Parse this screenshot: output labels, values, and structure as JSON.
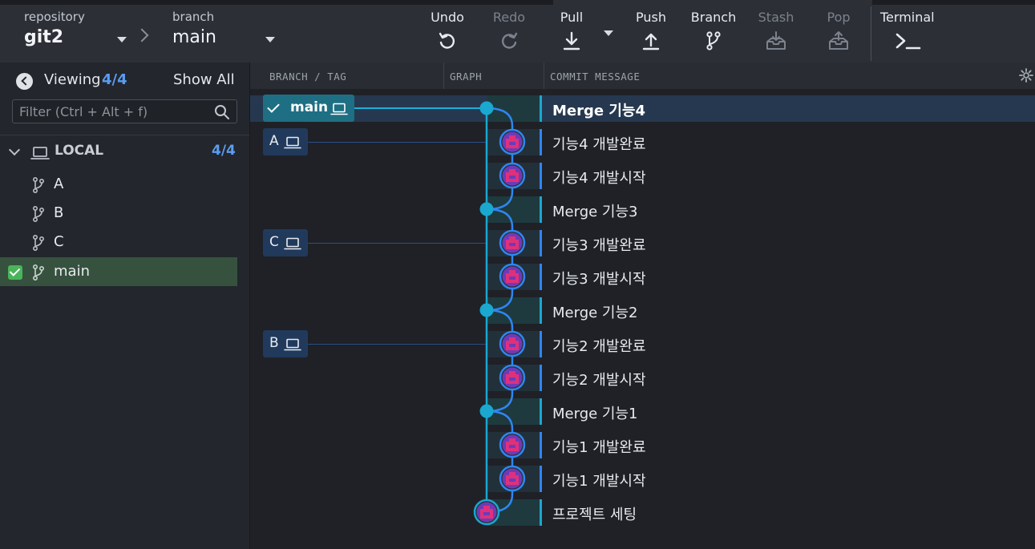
{
  "toolbar": {
    "repository_caption": "repository",
    "repository_name": "git2",
    "branch_caption": "branch",
    "branch_name": "main",
    "undo": "Undo",
    "redo": "Redo",
    "pull": "Pull",
    "push": "Push",
    "branch": "Branch",
    "stash": "Stash",
    "pop": "Pop",
    "terminal": "Terminal"
  },
  "sidebar": {
    "viewing_label": "Viewing",
    "viewing_count": "4/4",
    "show_all": "Show All",
    "filter_placeholder": "Filter (Ctrl + Alt + f)",
    "local_label": "LOCAL",
    "local_count": "4/4",
    "branches": [
      {
        "name": "A",
        "checked_out": false
      },
      {
        "name": "B",
        "checked_out": false
      },
      {
        "name": "C",
        "checked_out": false
      },
      {
        "name": "main",
        "checked_out": true
      }
    ]
  },
  "graph": {
    "col_branch_tag": "BRANCH / TAG",
    "col_graph": "GRAPH",
    "col_commit_message": "COMMIT MESSAGE",
    "labels": {
      "main": "main",
      "A": "A",
      "C": "C",
      "B": "B"
    },
    "commits": [
      {
        "message": "Merge 기능4",
        "type": "merge",
        "selected": true
      },
      {
        "message": "기능4 개발완료",
        "type": "commit"
      },
      {
        "message": "기능4 개발시작",
        "type": "commit"
      },
      {
        "message": "Merge 기능3",
        "type": "merge"
      },
      {
        "message": "기능3 개발완료",
        "type": "commit"
      },
      {
        "message": "기능3 개발시작",
        "type": "commit"
      },
      {
        "message": "Merge 기능2",
        "type": "merge"
      },
      {
        "message": "기능2 개발완료",
        "type": "commit"
      },
      {
        "message": "기능2 개발시작",
        "type": "commit"
      },
      {
        "message": "Merge 기능1",
        "type": "merge"
      },
      {
        "message": "기능1 개발완료",
        "type": "commit"
      },
      {
        "message": "기능1 개발시작",
        "type": "commit"
      },
      {
        "message": "프로젝트 세팅",
        "type": "root"
      }
    ]
  },
  "colors": {
    "main_lane": "#1aa7d0",
    "branch_lane": "#2f86f0",
    "checked_out": "#49b45a"
  }
}
